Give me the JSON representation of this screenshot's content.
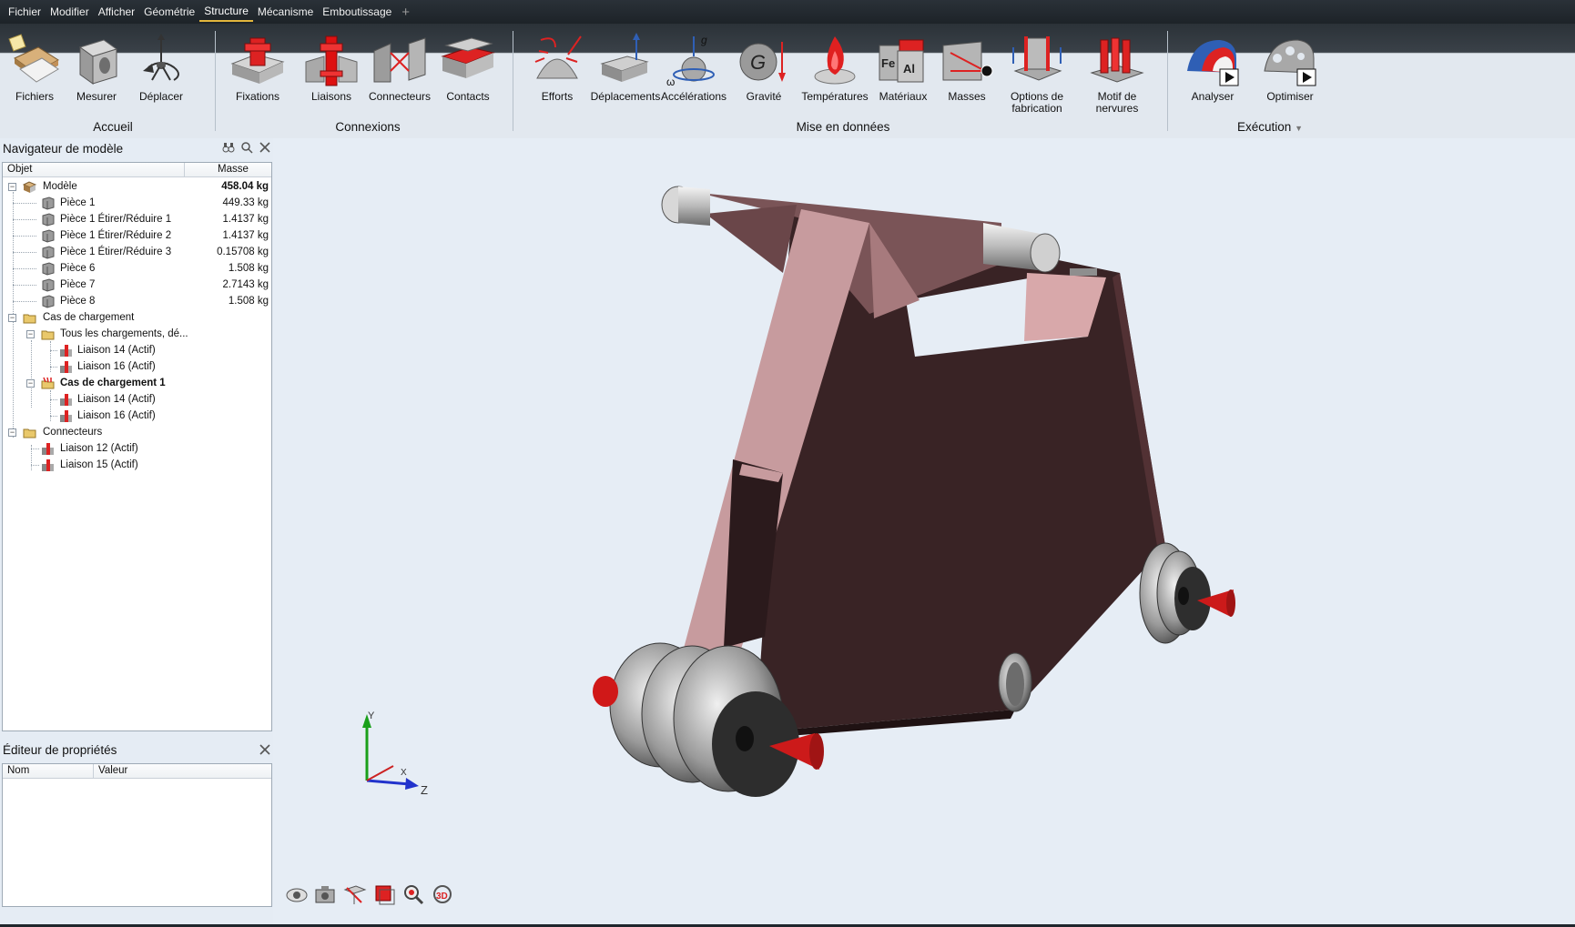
{
  "menu": {
    "items": [
      "Fichier",
      "Modifier",
      "Afficher",
      "Géométrie",
      "Structure",
      "Mécanisme",
      "Emboutissage"
    ],
    "active": "Structure"
  },
  "ribbon": {
    "groups": {
      "accueil": "Accueil",
      "connexions": "Connexions",
      "mise_en_donnees": "Mise en données",
      "execution": "Exécution"
    },
    "buttons": {
      "fichiers": "Fichiers",
      "mesurer": "Mesurer",
      "deplacer": "Déplacer",
      "fixations": "Fixations",
      "liaisons": "Liaisons",
      "connecteurs": "Connecteurs",
      "contacts": "Contacts",
      "efforts": "Efforts",
      "deplacements": "Déplacements",
      "accelerations": "Accélérations",
      "gravite": "Gravité",
      "temperatures": "Températures",
      "materiaux": "Matériaux",
      "masses": "Masses",
      "options_line1": "Options de",
      "options_line2": "fabrication",
      "motif": "Motif de nervures",
      "analyser": "Analyser",
      "optimiser": "Optimiser"
    },
    "icon_text": {
      "accel_g": "g",
      "accel_omega": "ω",
      "gravity_g": "G",
      "mat_fe": "Fe",
      "mat_al": "Al"
    }
  },
  "navigator": {
    "title": "Navigateur de modèle",
    "col_object": "Objet",
    "col_mass": "Masse",
    "rows": [
      {
        "label": "Modèle",
        "mass": "458.04 kg"
      },
      {
        "label": "Pièce 1",
        "mass": "449.33 kg"
      },
      {
        "label": "Pièce 1 Étirer/Réduire 1",
        "mass": "1.4137 kg"
      },
      {
        "label": "Pièce 1 Étirer/Réduire 2",
        "mass": "1.4137 kg"
      },
      {
        "label": "Pièce 1 Étirer/Réduire 3",
        "mass": "0.15708 kg"
      },
      {
        "label": "Pièce 6",
        "mass": "1.508 kg"
      },
      {
        "label": "Pièce 7",
        "mass": "2.7143 kg"
      },
      {
        "label": "Pièce 8",
        "mass": "1.508 kg"
      },
      {
        "label": "Cas de chargement",
        "mass": ""
      },
      {
        "label": "Tous les chargements, dé...",
        "mass": ""
      },
      {
        "label": "Liaison 14 (Actif)",
        "mass": ""
      },
      {
        "label": "Liaison 16 (Actif)",
        "mass": ""
      },
      {
        "label": "Cas de chargement 1",
        "mass": ""
      },
      {
        "label": "Liaison 14 (Actif)",
        "mass": ""
      },
      {
        "label": "Liaison 16 (Actif)",
        "mass": ""
      },
      {
        "label": "Connecteurs",
        "mass": ""
      },
      {
        "label": "Liaison 12 (Actif)",
        "mass": ""
      },
      {
        "label": "Liaison 15 (Actif)",
        "mass": ""
      }
    ]
  },
  "properties": {
    "title": "Éditeur de propriétés",
    "col_name": "Nom",
    "col_value": "Valeur"
  },
  "axis": {
    "y": "Y",
    "z": "Z",
    "x": "X"
  },
  "colors": {
    "accent": "#e3b63c",
    "panel_bg": "#e2e8ef",
    "part_dark": "#3a2426",
    "part_light": "#b98a8c",
    "arrow_red": "#cc1a1a"
  }
}
